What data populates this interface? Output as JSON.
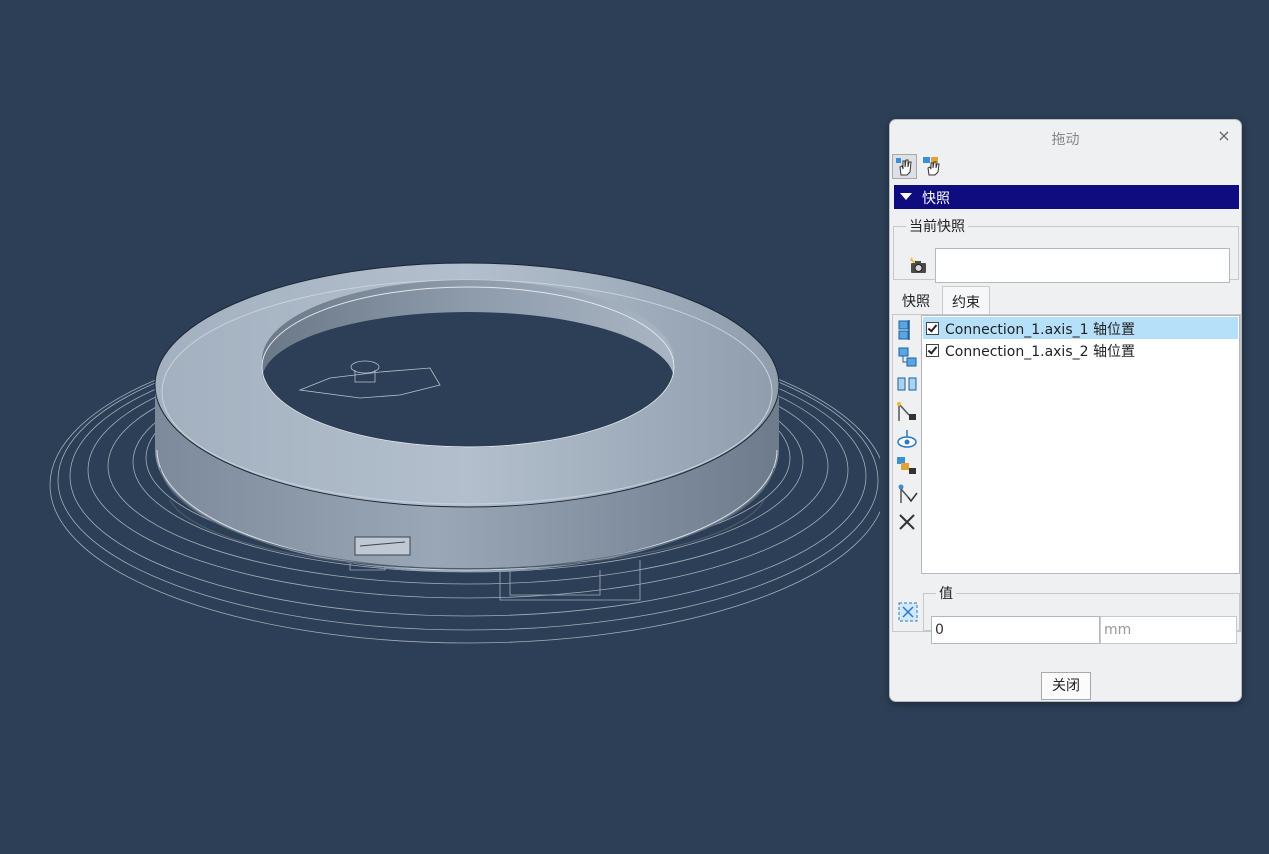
{
  "dialog": {
    "title": "拖动",
    "close_glyph": "×",
    "toolbar": [
      {
        "name": "drag-point-icon",
        "active": true
      },
      {
        "name": "drag-body-icon",
        "active": false
      }
    ],
    "section_label": "快照",
    "current_snapshot_label": "当前快照",
    "current_snapshot_value": "",
    "tabs": [
      {
        "label": "快照",
        "active": false
      },
      {
        "label": "约束",
        "active": true
      }
    ],
    "side_icons": [
      "align-left-icon",
      "align-offset-icon",
      "align-parallel-icon",
      "motion-axis-icon",
      "orient-eye-icon",
      "locked-bodies-icon",
      "enable-connection-icon",
      "delete-icon"
    ],
    "constraints": [
      {
        "label": "Connection_1.axis_1 轴位置",
        "checked": true,
        "selected": true
      },
      {
        "label": "Connection_1.axis_2 轴位置",
        "checked": true,
        "selected": false
      }
    ],
    "value_label": "值",
    "value": "0",
    "unit": "mm",
    "close_label": "关闭"
  },
  "colors": {
    "background": "#2c3f56",
    "section_header": "#0e0c7e",
    "selection": "#b6e0fa",
    "model_surface": "#8e9dae"
  }
}
